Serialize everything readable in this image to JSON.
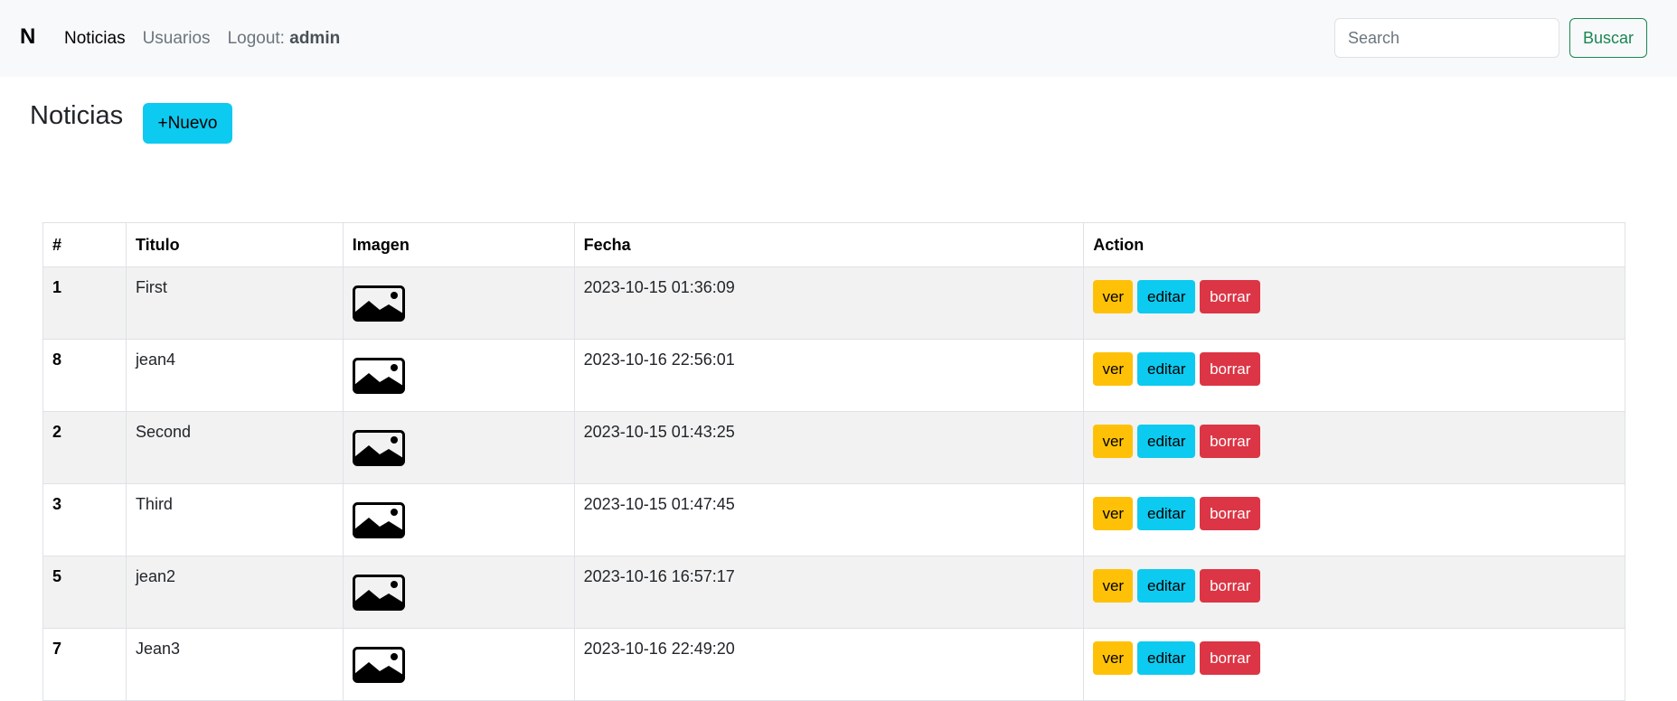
{
  "navbar": {
    "brand": "N",
    "links": [
      "Noticias",
      "Usuarios"
    ],
    "logout_label": "Logout:",
    "logout_user": "admin",
    "search_placeholder": "Search",
    "search_button": "Buscar"
  },
  "page": {
    "title": "Noticias",
    "new_button": "+Nuevo"
  },
  "table": {
    "headers": [
      "#",
      "Titulo",
      "Imagen",
      "Fecha",
      "Action"
    ],
    "action_labels": {
      "view": "ver",
      "edit": "editar",
      "delete": "borrar"
    },
    "rows": [
      {
        "id": "1",
        "titulo": "First",
        "fecha": "2023-10-15 01:36:09"
      },
      {
        "id": "8",
        "titulo": "jean4",
        "fecha": "2023-10-16 22:56:01"
      },
      {
        "id": "2",
        "titulo": "Second",
        "fecha": "2023-10-15 01:43:25"
      },
      {
        "id": "3",
        "titulo": "Third",
        "fecha": "2023-10-15 01:47:45"
      },
      {
        "id": "5",
        "titulo": "jean2",
        "fecha": "2023-10-16 16:57:17"
      },
      {
        "id": "7",
        "titulo": "Jean3",
        "fecha": "2023-10-16 22:49:20"
      }
    ]
  },
  "colors": {
    "navbar_bg": "#f8f9fa",
    "info": "#0dcaf0",
    "warning": "#ffc107",
    "danger": "#dc3545",
    "success": "#198754"
  }
}
